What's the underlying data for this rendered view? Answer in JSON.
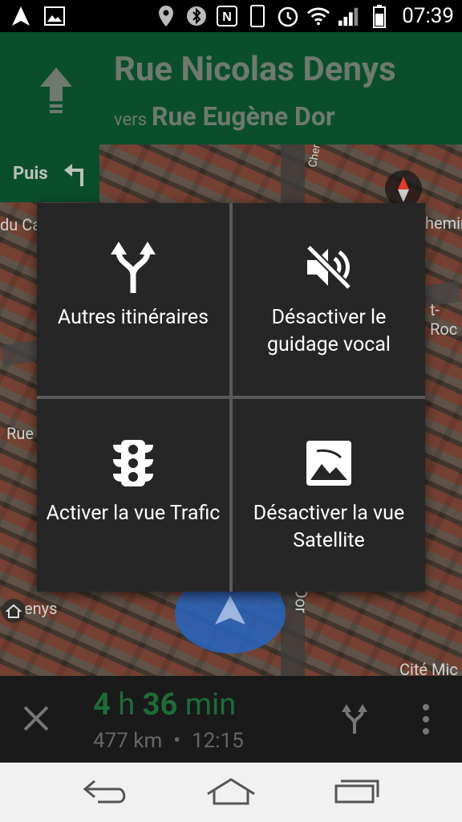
{
  "status_bar": {
    "time": "07:39",
    "icons": [
      "navigation-icon",
      "gallery-icon",
      "location-icon",
      "bluetooth-icon",
      "nfc-icon",
      "phone-icon",
      "alarm-icon",
      "wifi-icon",
      "signal-icon",
      "battery-icon"
    ]
  },
  "navigation": {
    "street": "Rue Nicolas Denys",
    "towards_label": "vers",
    "towards_street": "Rue Eugène Dor",
    "then_label": "Puis"
  },
  "map_labels": {
    "top_right": "Cher",
    "right_1": "hemin",
    "right_2": "t-Roc",
    "left_1": "du Ca",
    "left_2": "Rue",
    "bottom_left": "enys",
    "bottom_mid": "Dor",
    "bottom_right": "Cité Mic"
  },
  "menu": {
    "items": [
      {
        "label": "Autres itinéraires",
        "icon": "alternate-routes-icon"
      },
      {
        "label": "Désactiver le guidage vocal",
        "icon": "volume-off-icon"
      },
      {
        "label": "Activer la vue Trafic",
        "icon": "traffic-light-icon"
      },
      {
        "label": "Désactiver la vue Satellite",
        "icon": "satellite-image-icon"
      }
    ]
  },
  "trip": {
    "eta_hours": "4",
    "eta_hours_unit": "h",
    "eta_minutes": "36",
    "eta_minutes_unit": "min",
    "distance": "477 km",
    "separator": "•",
    "arrival_time": "12:15"
  },
  "colors": {
    "header_green": "#0b4e2e",
    "eta_green": "#1f6b38",
    "menu_bg": "#262626"
  }
}
